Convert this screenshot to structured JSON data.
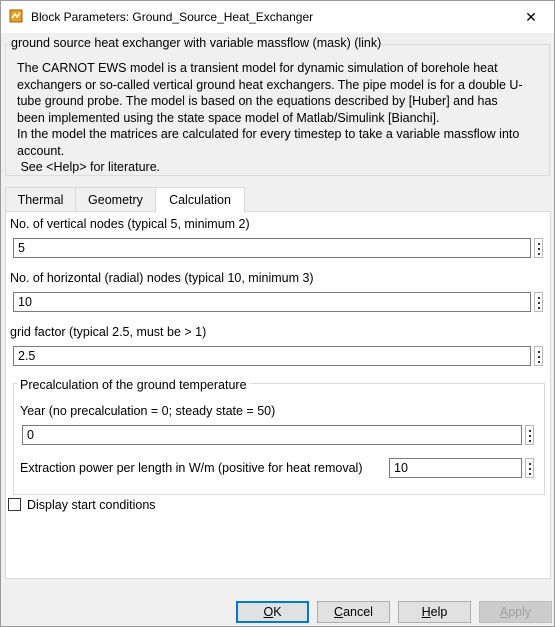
{
  "window": {
    "title": "Block Parameters: Ground_Source_Heat_Exchanger"
  },
  "mask": {
    "group_title": "ground source heat exchanger with variable massflow (mask) (link)",
    "description_lines": [
      "The CARNOT EWS model is a transient model for dynamic simulation of borehole heat",
      "exchangers or so-called vertical ground heat exchangers. The pipe model is for a double U-",
      "tube ground probe.  The model is based on the equations described by [Huber] and has",
      "been implemented using the state space model of Matlab/Simulink [Bianchi].",
      "In the model the matrices are calculated for every timestep to take a variable massflow into",
      "account.",
      " See <Help> for literature."
    ]
  },
  "tabs": [
    {
      "label": "Thermal",
      "active": false
    },
    {
      "label": "Geometry",
      "active": false
    },
    {
      "label": "Calculation",
      "active": true
    }
  ],
  "calculation": {
    "vertical_nodes": {
      "label": "No. of vertical nodes (typical 5, minimum 2)",
      "value": "5"
    },
    "horizontal_nodes": {
      "label": "No. of horizontal (radial) nodes (typical 10, minimum 3)",
      "value": "10"
    },
    "grid_factor": {
      "label": "grid factor (typical 2.5, must be > 1)",
      "value": "2.5"
    },
    "precalc": {
      "title": "Precalculation of the ground temperature",
      "year": {
        "label": "Year (no precalculation = 0; steady state = 50)",
        "value": "0"
      },
      "extraction": {
        "label": "Extraction power per length in W/m (positive for heat removal)",
        "value": "10"
      }
    },
    "display_start": {
      "label": "Display start conditions",
      "checked": false
    }
  },
  "buttons": {
    "ok": {
      "mnemonic": "O",
      "rest": "K"
    },
    "cancel": {
      "mnemonic": "C",
      "rest": "ancel"
    },
    "help": {
      "mnemonic": "H",
      "rest": "elp"
    },
    "apply": {
      "mnemonic": "A",
      "rest": "pply",
      "enabled": false
    }
  },
  "icons": {
    "app": "simulink-block-icon",
    "close": "close-icon",
    "more": "vertical-ellipsis-icon"
  },
  "colors": {
    "accent": "#0078d7",
    "panel": "#ffffff",
    "window": "#f0f0f0"
  }
}
